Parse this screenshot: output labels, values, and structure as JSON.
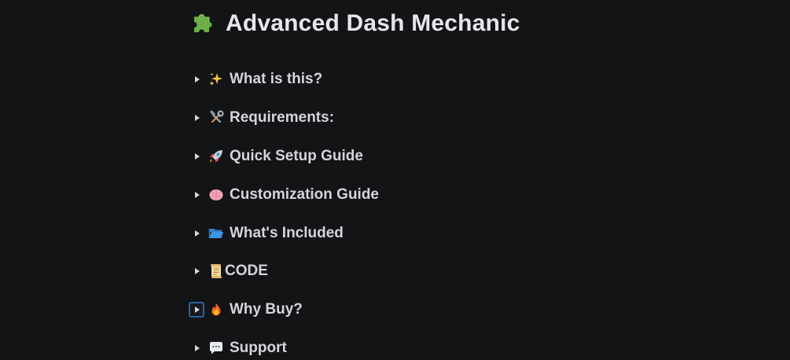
{
  "page": {
    "title": "Advanced Dash Mechanic",
    "title_icon": "puzzle-piece-icon"
  },
  "toggles": [
    {
      "icon": "sparkles-icon",
      "label": "What is this?"
    },
    {
      "icon": "hammer-wrench-icon",
      "label": "Requirements:"
    },
    {
      "icon": "rocket-icon",
      "label": "Quick Setup Guide"
    },
    {
      "icon": "brain-icon",
      "label": "Customization Guide"
    },
    {
      "icon": "open-folder-icon",
      "label": "What's Included"
    },
    {
      "icon": "scroll-icon",
      "label": "CODE"
    },
    {
      "icon": "fire-icon",
      "label": "Why Buy?"
    },
    {
      "icon": "speech-bubble-icon",
      "label": "Support"
    }
  ],
  "colors": {
    "background": "#131416",
    "text": "#d3d5da",
    "focus_ring": "#2a63a4",
    "puzzle_green": "#6bb04a"
  }
}
